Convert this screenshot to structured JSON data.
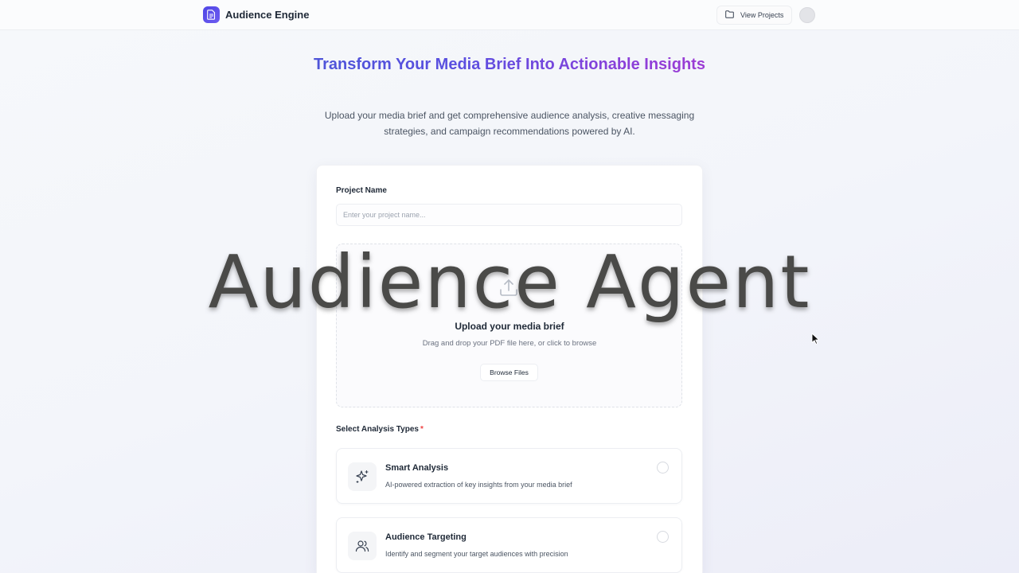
{
  "header": {
    "app_name": "Audience Engine",
    "logo_icon": "document-icon",
    "view_projects_label": "View Projects",
    "view_projects_icon": "folder-icon",
    "avatar": "user-avatar"
  },
  "hero": {
    "title": "Transform Your Media Brief Into Actionable Insights",
    "subtitle": "Upload your media brief and get comprehensive audience analysis, creative messaging strategies, and campaign recommendations powered by AI."
  },
  "form": {
    "project_name_label": "Project Name",
    "project_name_placeholder": "Enter your project name...",
    "project_name_value": "",
    "upload": {
      "icon": "upload-icon",
      "title": "Upload your media brief",
      "subtitle": "Drag and drop your PDF file here, or click to browse",
      "browse_label": "Browse Files"
    },
    "analysis_label": "Select Analysis Types",
    "required_marker": "*",
    "analysis_options": [
      {
        "icon": "sparkles-icon",
        "title": "Smart Analysis",
        "description": "AI-powered extraction of key insights from your media brief",
        "selected": false
      },
      {
        "icon": "users-icon",
        "title": "Audience Targeting",
        "description": "Identify and segment your target audiences with precision",
        "selected": false
      }
    ]
  },
  "overlay": {
    "watermark_text": "Audience Agent"
  },
  "colors": {
    "brand": "#4f46e5",
    "title_gradient_start": "#4a56d6",
    "title_gradient_end": "#a63bd1",
    "required": "#ef4444"
  }
}
